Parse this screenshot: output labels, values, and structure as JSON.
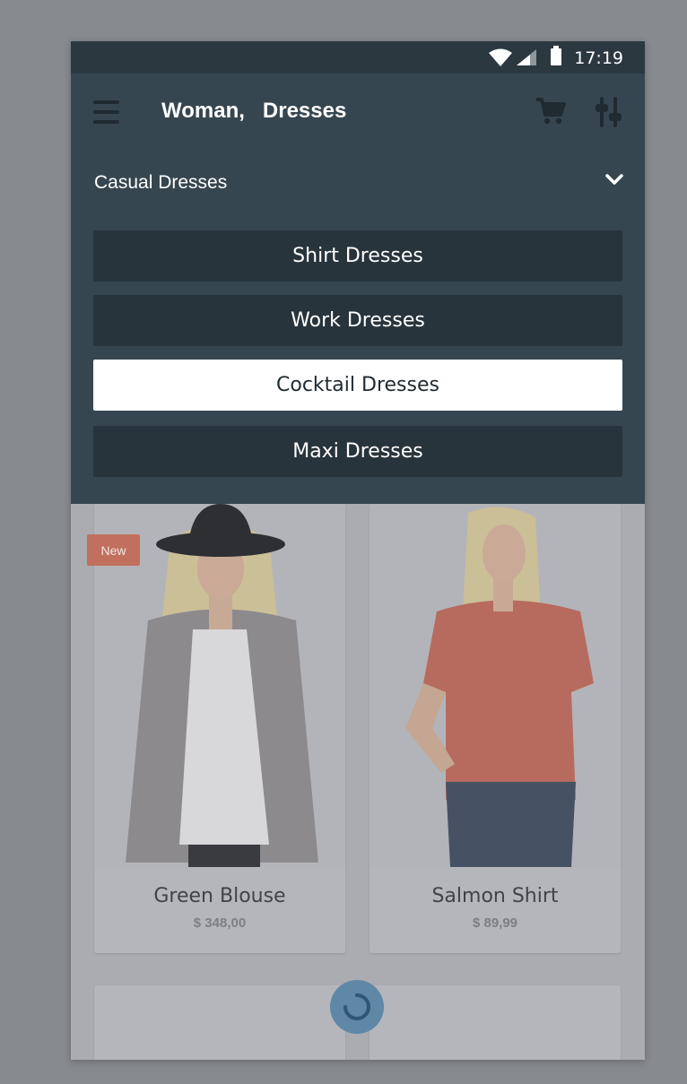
{
  "status_bar": {
    "time": "17:19"
  },
  "app_bar": {
    "title": "Woman,   Dresses"
  },
  "category_filter": {
    "selected": "Casual Dresses",
    "options": [
      {
        "label": "Shirt Dresses",
        "selected": false
      },
      {
        "label": "Work Dresses",
        "selected": false
      },
      {
        "label": "Cocktail Dresses",
        "selected": true
      },
      {
        "label": "Maxi Dresses",
        "selected": false
      }
    ]
  },
  "products": [
    {
      "name": "Green Blouse",
      "price": "$ 348,00",
      "badge": "New"
    },
    {
      "name": "Salmon Shirt",
      "price": "$ 89,99"
    }
  ]
}
